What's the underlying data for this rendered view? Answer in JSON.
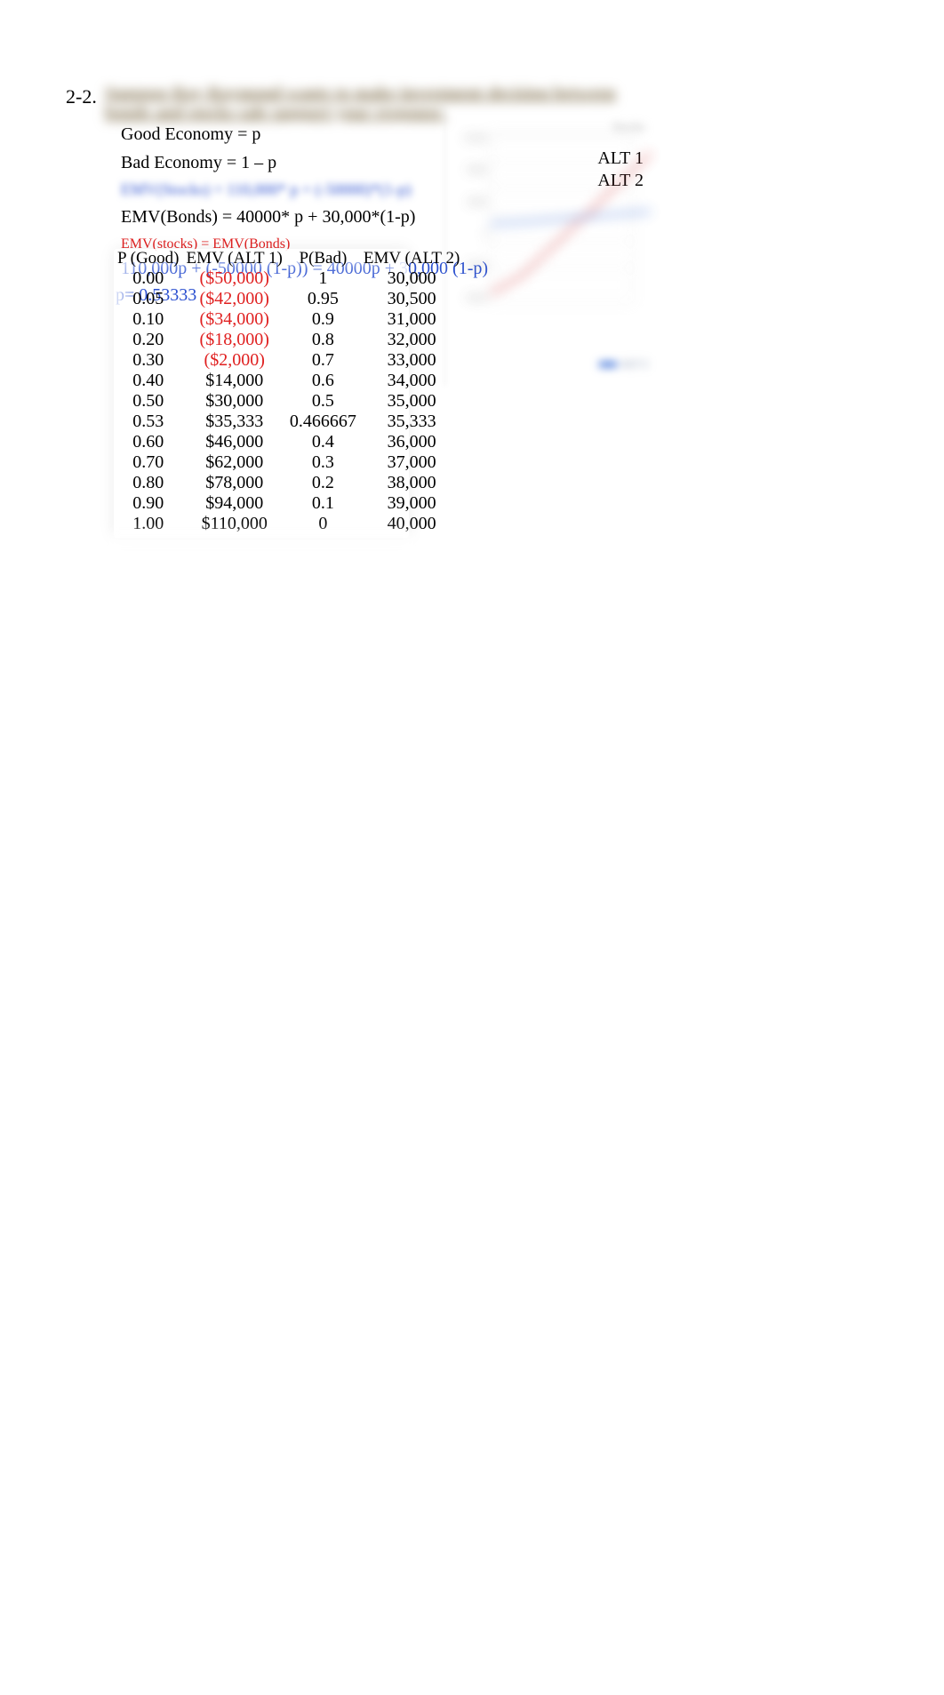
{
  "problem_number": "2-2.",
  "blurred_title": "Suppose Ray Raymond wants to make investment decision between bonds and stocks sale support your response.",
  "lines": {
    "good": "Good Economy = p",
    "bad": "Bad Economy = 1 – p",
    "emvs_blur": "EMV(Stocks) = 110,000* p + (-50000)*(1-p)",
    "emvb": "EMV(Bonds) = 40000* p + 30,000*(1-p)",
    "emv_eq": "EMV(stocks) = EMV(Bonds)",
    "eq": "110,000p + (-50000 (1-p)) = 40000p + 30,000 (1-p)",
    "p": "p= 0.53333"
  },
  "legend": {
    "alt1": "ALT 1",
    "alt2": "ALT 2"
  },
  "corner_label": "Stocks",
  "table": {
    "headers": [
      "P (Good)",
      "EMV (ALT 1)",
      "P(Bad)",
      "EMV (ALT 2)"
    ],
    "rows": [
      {
        "pg": "0.00",
        "e1": "($50,000)",
        "e1_neg": true,
        "pb": "1",
        "e2": "30,000"
      },
      {
        "pg": "0.05",
        "e1": "($42,000)",
        "e1_neg": true,
        "pb": "0.95",
        "e2": "30,500"
      },
      {
        "pg": "0.10",
        "e1": "($34,000)",
        "e1_neg": true,
        "pb": "0.9",
        "e2": "31,000"
      },
      {
        "pg": "0.20",
        "e1": "($18,000)",
        "e1_neg": true,
        "pb": "0.8",
        "e2": "32,000"
      },
      {
        "pg": "0.30",
        "e1": "($2,000)",
        "e1_neg": true,
        "pb": "0.7",
        "e2": "33,000"
      },
      {
        "pg": "0.40",
        "e1": "$14,000",
        "e1_neg": false,
        "pb": "0.6",
        "e2": "34,000"
      },
      {
        "pg": "0.50",
        "e1": "$30,000",
        "e1_neg": false,
        "pb": "0.5",
        "e2": "35,000"
      },
      {
        "pg": "0.53",
        "e1": "$35,333",
        "e1_neg": false,
        "pb": "0.466667",
        "e2": "35,333"
      },
      {
        "pg": "0.60",
        "e1": "$46,000",
        "e1_neg": false,
        "pb": "0.4",
        "e2": "36,000"
      },
      {
        "pg": "0.70",
        "e1": "$62,000",
        "e1_neg": false,
        "pb": "0.3",
        "e2": "37,000"
      },
      {
        "pg": "0.80",
        "e1": "$78,000",
        "e1_neg": false,
        "pb": "0.2",
        "e2": "38,000"
      },
      {
        "pg": "0.90",
        "e1": "$94,000",
        "e1_neg": false,
        "pb": "0.1",
        "e2": "39,000"
      },
      {
        "pg": "1.00",
        "e1": "$110,000",
        "e1_neg": false,
        "pb": "0",
        "e2": "40,000"
      }
    ]
  },
  "chart_data": {
    "type": "line",
    "title": "",
    "xlabel": "P (Good)",
    "ylabel": "EMV",
    "x": [
      0.0,
      0.05,
      0.1,
      0.2,
      0.3,
      0.4,
      0.5,
      0.53,
      0.6,
      0.7,
      0.8,
      0.9,
      1.0
    ],
    "series": [
      {
        "name": "ALT 1",
        "values": [
          -50000,
          -42000,
          -34000,
          -18000,
          -2000,
          14000,
          30000,
          35333,
          46000,
          62000,
          78000,
          94000,
          110000
        ],
        "color": "#d03030"
      },
      {
        "name": "ALT 2",
        "values": [
          30000,
          30500,
          31000,
          32000,
          33000,
          34000,
          35000,
          35333,
          36000,
          37000,
          38000,
          39000,
          40000
        ],
        "color": "#3a6fd8"
      }
    ],
    "xlim": [
      0,
      1
    ],
    "ylim": [
      -60000,
      120000
    ]
  },
  "footer_legend_text": "ALT 2"
}
